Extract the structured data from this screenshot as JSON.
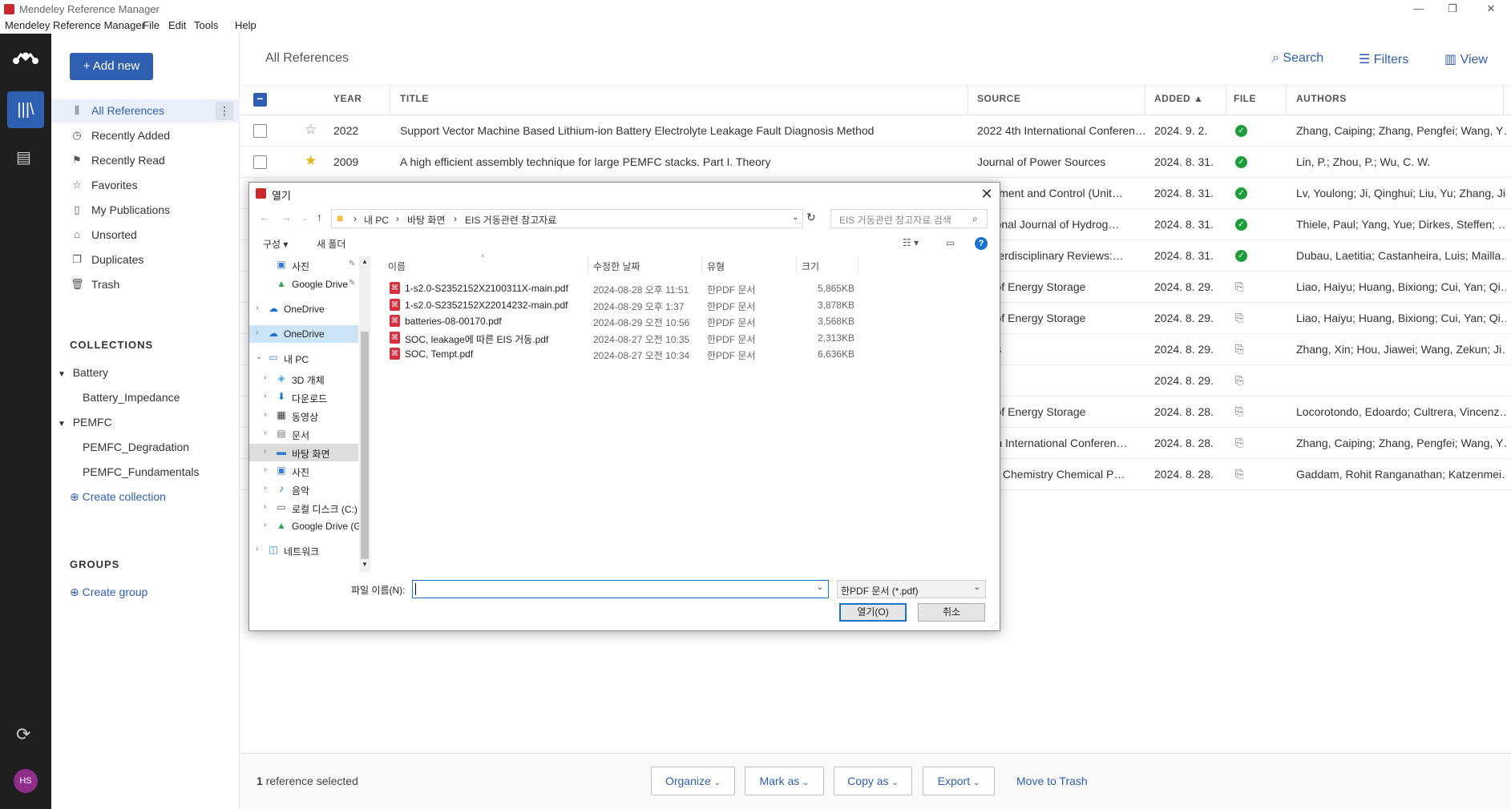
{
  "window": {
    "title": "Mendeley Reference Manager"
  },
  "menu": {
    "app": "Mendeley Reference Manager",
    "file": "File",
    "edit": "Edit",
    "tools": "Tools",
    "help": "Help"
  },
  "sidebar": {
    "add_new": "Add new",
    "items": [
      {
        "label": "All References",
        "icon": "library-icon"
      },
      {
        "label": "Recently Added",
        "icon": "clock-icon"
      },
      {
        "label": "Recently Read",
        "icon": "bookmark-icon"
      },
      {
        "label": "Favorites",
        "icon": "star-icon"
      },
      {
        "label": "My Publications",
        "icon": "document-icon"
      },
      {
        "label": "Unsorted",
        "icon": "inbox-icon"
      },
      {
        "label": "Duplicates",
        "icon": "copy-icon"
      },
      {
        "label": "Trash",
        "icon": "trash-icon"
      }
    ],
    "collections_heading": "COLLECTIONS",
    "collections": [
      {
        "label": "Battery",
        "children": [
          "Battery_Impedance"
        ]
      },
      {
        "label": "PEMFC",
        "children": [
          "PEMFC_Degradation",
          "PEMFC_Fundamentals"
        ]
      }
    ],
    "create_collection": "Create collection",
    "groups_heading": "GROUPS",
    "create_group": "Create group",
    "avatar": "HS"
  },
  "main": {
    "title": "All References",
    "search": "Search",
    "filters": "Filters",
    "view": "View",
    "columns": {
      "year": "YEAR",
      "title": "TITLE",
      "source": "SOURCE",
      "added": "ADDED ▲",
      "file": "FILE",
      "authors": "AUTHORS"
    },
    "rows": [
      {
        "fav": false,
        "year": "2022",
        "title": "Support Vector Machine Based Lithium-ion Battery Electrolyte Leakage Fault Diagnosis Method",
        "source": "2022 4th International Conferen…",
        "added": "2024. 9. 2.",
        "file": "ok",
        "authors": "Zhang, Caiping; Zhang, Pengfei; Wang, Y…"
      },
      {
        "fav": true,
        "year": "2009",
        "title": "A high efficient assembly technique for large PEMFC stacks. Part I. Theory",
        "source": "Journal of Power Sources",
        "added": "2024. 8. 31.",
        "file": "ok",
        "authors": "Lin, P.; Zhou, P.; Wu, C. W."
      },
      {
        "fav": false,
        "year": "",
        "title": "",
        "source": "surement and Control (Unit…",
        "added": "2024. 8. 31.",
        "file": "ok",
        "authors": "Lv, Youlong; Ji, Qinghui; Liu, Yu; Zhang, Jie"
      },
      {
        "fav": false,
        "year": "",
        "title": "",
        "source": "national Journal of Hydrog…",
        "added": "2024. 8. 31.",
        "file": "ok",
        "authors": "Thiele, Paul; Yang, Yue; Dirkes, Steffen; …"
      },
      {
        "fav": false,
        "year": "",
        "title": "",
        "source": "y Interdisciplinary Reviews:…",
        "added": "2024. 8. 31.",
        "file": "ok",
        "authors": "Dubau, Laetitia; Castanheira, Luis; Mailla…"
      },
      {
        "fav": false,
        "year": "",
        "title": "",
        "source": "nal of Energy Storage",
        "added": "2024. 8. 29.",
        "file": "add",
        "authors": "Liao, Haiyu; Huang, Bixiong; Cui, Yan; Qi…"
      },
      {
        "fav": false,
        "year": "",
        "title": "",
        "source": "nal of Energy Storage",
        "added": "2024. 8. 29.",
        "file": "add",
        "authors": "Liao, Haiyu; Huang, Bixiong; Cui, Yan; Qi…"
      },
      {
        "fav": false,
        "year": "",
        "title": "",
        "source": "eries",
        "added": "2024. 8. 29.",
        "file": "add",
        "authors": "Zhang, Xin; Hou, Jiawei; Wang, Zekun; Ji…"
      },
      {
        "fav": false,
        "year": "",
        "title": "",
        "source": "",
        "added": "2024. 8. 29.",
        "file": "add",
        "authors": ""
      },
      {
        "fav": false,
        "year": "",
        "title": "",
        "source": "nal of Energy Storage",
        "added": "2024. 8. 28.",
        "file": "add",
        "authors": "Locorotondo, Edoardo; Cultrera, Vincenz…"
      },
      {
        "fav": false,
        "year": "",
        "title": "",
        "source": "2 4th International Conferen…",
        "added": "2024. 8. 28.",
        "file": "add",
        "authors": "Zhang, Caiping; Zhang, Pengfei; Wang, Y…"
      },
      {
        "fav": false,
        "year": "",
        "title": "",
        "source": "sical Chemistry Chemical P…",
        "added": "2024. 8. 28.",
        "file": "add",
        "authors": "Gaddam, Rohit Ranganathan; Katzenmei…"
      }
    ]
  },
  "bottombar": {
    "selected_count": "1",
    "selected_text": "reference selected",
    "organize": "Organize",
    "mark_as": "Mark as",
    "copy_as": "Copy as",
    "export": "Export",
    "move_to_trash": "Move to Trash"
  },
  "dialog": {
    "title": "열기",
    "breadcrumb": [
      "내 PC",
      "바탕 화면",
      "EIS 거동관련 참고자료"
    ],
    "search_placeholder": "EIS 거동관련 참고자료 검색",
    "organize": "구성 ▾",
    "new_folder": "새 폴더",
    "tree": [
      {
        "label": "사진",
        "icon": "pictures-icon",
        "indent": 1,
        "pinned": true
      },
      {
        "label": "Google Drive",
        "icon": "google-drive-icon",
        "indent": 1,
        "pinned": true
      },
      {
        "label": "OneDrive",
        "icon": "onedrive-icon",
        "indent": 0
      },
      {
        "label": "OneDrive",
        "icon": "onedrive-icon",
        "indent": 0,
        "highlight": true
      },
      {
        "label": "내 PC",
        "icon": "pc-icon",
        "indent": 0,
        "expanded": true
      },
      {
        "label": "3D 개체",
        "icon": "3d-objects-icon",
        "indent": 1
      },
      {
        "label": "다운로드",
        "icon": "download-icon",
        "indent": 1
      },
      {
        "label": "동영상",
        "icon": "video-icon",
        "indent": 1
      },
      {
        "label": "문서",
        "icon": "documents-icon",
        "indent": 1
      },
      {
        "label": "바탕 화면",
        "icon": "desktop-icon",
        "indent": 1,
        "selected": true
      },
      {
        "label": "사진",
        "icon": "pictures-icon",
        "indent": 1
      },
      {
        "label": "음악",
        "icon": "music-icon",
        "indent": 1
      },
      {
        "label": "로컬 디스크 (C:)",
        "icon": "disk-icon",
        "indent": 1
      },
      {
        "label": "Google Drive (G",
        "icon": "google-drive-icon",
        "indent": 1
      },
      {
        "label": "네트워크",
        "icon": "network-icon",
        "indent": 0
      }
    ],
    "columns": {
      "name": "이름",
      "modified": "수정한 날짜",
      "type": "유형",
      "size": "크기"
    },
    "files": [
      {
        "name": "1-s2.0-S2352152X2100311X-main.pdf",
        "modified": "2024-08-28 오후 11:51",
        "type": "한PDF 문서",
        "size": "5,865KB"
      },
      {
        "name": "1-s2.0-S2352152X22014232-main.pdf",
        "modified": "2024-08-29 오후 1:37",
        "type": "한PDF 문서",
        "size": "3,878KB"
      },
      {
        "name": "batteries-08-00170.pdf",
        "modified": "2024-08-29 오전 10:56",
        "type": "한PDF 문서",
        "size": "3,568KB"
      },
      {
        "name": "SOC, leakage에 따른 EIS 거동.pdf",
        "modified": "2024-08-27 오전 10:35",
        "type": "한PDF 문서",
        "size": "2,313KB"
      },
      {
        "name": "SOC, Tempt.pdf",
        "modified": "2024-08-27 오전 10:34",
        "type": "한PDF 문서",
        "size": "6,636KB"
      }
    ],
    "filename_label": "파일 이름(N):",
    "filename_value": "",
    "filetype": "한PDF 문서 (*.pdf)",
    "open": "열기(O)",
    "cancel": "취소"
  }
}
